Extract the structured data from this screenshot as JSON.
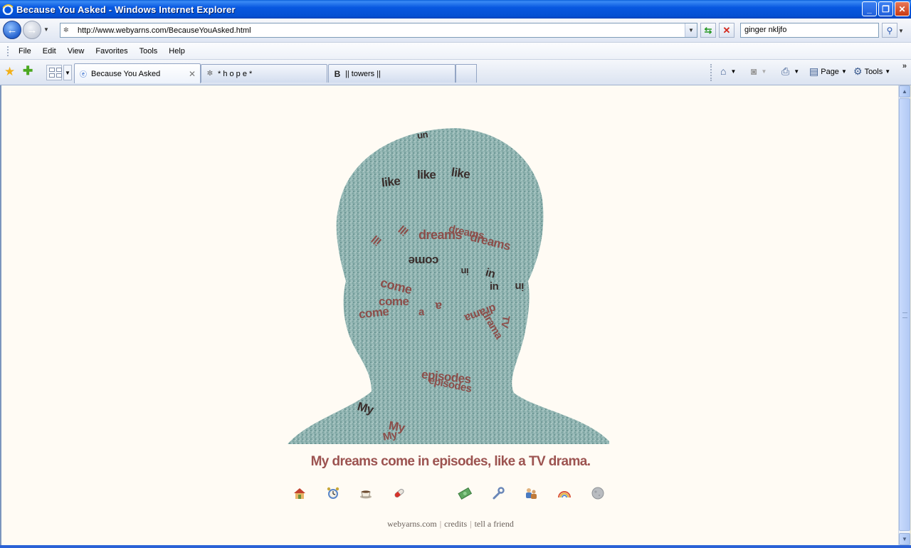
{
  "window": {
    "title": "Because You Asked - Windows Internet Explorer",
    "min_label": "_",
    "max_label": "❐",
    "close_label": "✕"
  },
  "address": {
    "url": "http://www.webyarns.com/BecauseYouAsked.html",
    "search_value": "ginger nkljfo"
  },
  "menu": {
    "file": "File",
    "edit": "Edit",
    "view": "View",
    "favorites": "Favorites",
    "tools": "Tools",
    "help": "Help"
  },
  "tabs": [
    {
      "label": "Because You Asked",
      "icon": "ie-icon"
    },
    {
      "label": "* h o p e *",
      "icon": "page-icon"
    },
    {
      "label": "|| towers ||",
      "icon": "blogger-icon",
      "icon_glyph": "B"
    }
  ],
  "toolbar": {
    "page_label": "Page",
    "tools_label": "Tools"
  },
  "page": {
    "floating_words": [
      {
        "text": "like"
      },
      {
        "text": "like"
      },
      {
        "text": "like"
      },
      {
        "text": "ill"
      },
      {
        "text": "ill"
      },
      {
        "text": "dreams"
      },
      {
        "text": "dreams"
      },
      {
        "text": "dreams"
      },
      {
        "text": "come"
      },
      {
        "text": "in"
      },
      {
        "text": "in"
      },
      {
        "text": "in"
      },
      {
        "text": "in"
      },
      {
        "text": "come"
      },
      {
        "text": "come"
      },
      {
        "text": "come"
      },
      {
        "text": "a"
      },
      {
        "text": "a"
      },
      {
        "text": "drama"
      },
      {
        "text": "drama"
      },
      {
        "text": "TV"
      },
      {
        "text": "episodes"
      },
      {
        "text": "episodes"
      },
      {
        "text": "My"
      },
      {
        "text": "My"
      },
      {
        "text": "My"
      },
      {
        "text": "un"
      }
    ],
    "caption": "My dreams come in episodes, like a TV drama.",
    "nav_icons": [
      "home-icon",
      "alarm-clock-icon",
      "coffee-cup-icon",
      "pill-icon",
      "money-icon",
      "wrench-icon",
      "people-icon",
      "rainbow-icon",
      "moon-icon"
    ],
    "footer": {
      "site": "webyarns.com",
      "sep": "|",
      "credits": "credits",
      "tell": "tell a friend"
    }
  }
}
